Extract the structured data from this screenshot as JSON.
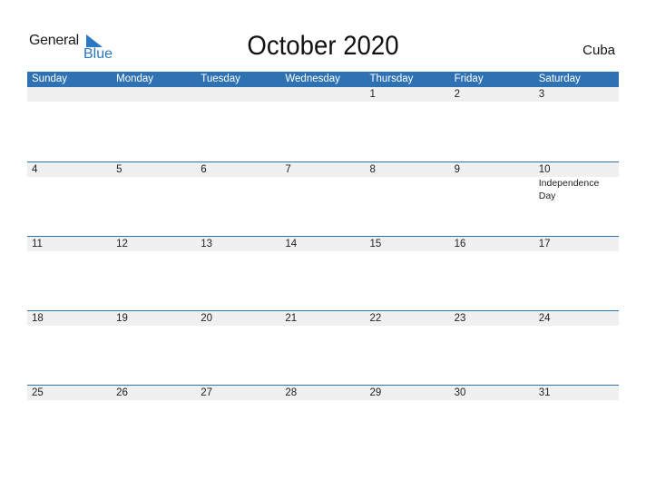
{
  "logo": {
    "general": "General",
    "blue": "Blue"
  },
  "header": {
    "title": "October 2020",
    "country": "Cuba"
  },
  "weekdays": [
    "Sunday",
    "Monday",
    "Tuesday",
    "Wednesday",
    "Thursday",
    "Friday",
    "Saturday"
  ],
  "weeks": [
    {
      "days": [
        "",
        "",
        "",
        "",
        "1",
        "2",
        "3"
      ],
      "events": [
        "",
        "",
        "",
        "",
        "",
        "",
        ""
      ]
    },
    {
      "days": [
        "4",
        "5",
        "6",
        "7",
        "8",
        "9",
        "10"
      ],
      "events": [
        "",
        "",
        "",
        "",
        "",
        "",
        "Independence Day"
      ]
    },
    {
      "days": [
        "11",
        "12",
        "13",
        "14",
        "15",
        "16",
        "17"
      ],
      "events": [
        "",
        "",
        "",
        "",
        "",
        "",
        ""
      ]
    },
    {
      "days": [
        "18",
        "19",
        "20",
        "21",
        "22",
        "23",
        "24"
      ],
      "events": [
        "",
        "",
        "",
        "",
        "",
        "",
        ""
      ]
    },
    {
      "days": [
        "25",
        "26",
        "27",
        "28",
        "29",
        "30",
        "31"
      ],
      "events": [
        "",
        "",
        "",
        "",
        "",
        "",
        ""
      ]
    }
  ],
  "colors": {
    "accent": "#2f72b4",
    "brand_blue": "#2a78c2",
    "row_shade": "#f0f0f0"
  }
}
